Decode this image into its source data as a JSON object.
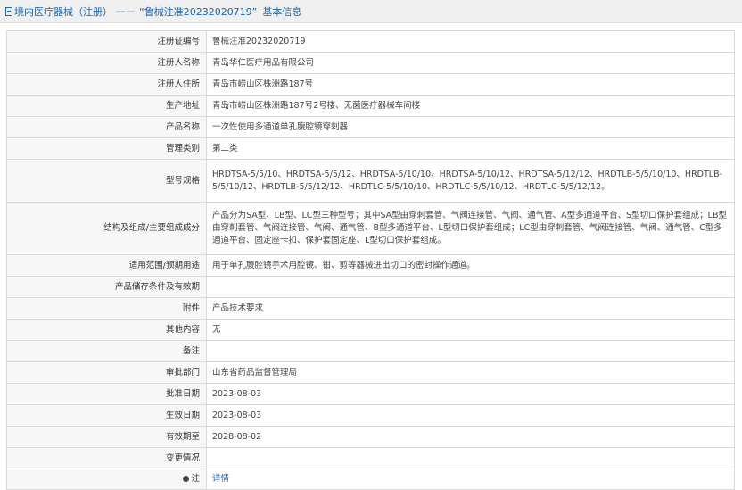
{
  "header": {
    "category": "境内医疗器械（注册）",
    "separator": "——",
    "record_title": "“鲁械注准20232020719”",
    "section": "基本信息"
  },
  "rows": [
    {
      "label": "注册证编号",
      "value": "鲁械注准20232020719"
    },
    {
      "label": "注册人名称",
      "value": "青岛华仁医疗用品有限公司"
    },
    {
      "label": "注册人住所",
      "value": "青岛市崂山区株洲路187号"
    },
    {
      "label": "生产地址",
      "value": "青岛市崂山区株洲路187号2号楼、无菌医疗器械车间楼"
    },
    {
      "label": "产品名称",
      "value": "一次性使用多通道单孔腹腔镜穿刺器"
    },
    {
      "label": "管理类别",
      "value": "第二类"
    },
    {
      "label": "型号规格",
      "value": "HRDTSA-5/5/10、HRDTSA-5/5/12、HRDTSA-5/10/10、HRDTSA-5/10/12、HRDTSA-5/12/12、HRDTLB-5/5/10/10、HRDTLB-5/5/10/12、HRDTLB-5/5/12/12、HRDTLC-5/5/10/10、HRDTLC-5/5/10/12、HRDTLC-5/5/12/12。"
    },
    {
      "label": "结构及组成/主要组成成分",
      "value": "产品分为SA型、LB型、LC型三种型号；其中SA型由穿刺套管、气阀连接管、气阀、通气管、A型多通道平台、S型切口保护套组成；LB型由穿刺套管、气阀连接管、气阀、通气管、B型多通道平台、L型切口保护套组成；LC型由穿刺套管、气阀连接管、气阀、通气管、C型多通道平台、固定座卡扣、保护套固定座、L型切口保护套组成。"
    },
    {
      "label": "适用范围/预期用途",
      "value": "用于单孔腹腔镜手术用腔镜、钳、剪等器械进出切口的密封操作通道。"
    },
    {
      "label": "产品储存条件及有效期",
      "value": ""
    },
    {
      "label": "附件",
      "value": "产品技术要求"
    },
    {
      "label": "其他内容",
      "value": "无"
    },
    {
      "label": "备注",
      "value": ""
    },
    {
      "label": "审批部门",
      "value": "山东省药品监督管理局"
    },
    {
      "label": "批准日期",
      "value": "2023-08-03"
    },
    {
      "label": "生效日期",
      "value": "2023-08-03"
    },
    {
      "label": "有效期至",
      "value": "2028-08-02"
    },
    {
      "label": "变更情况",
      "value": ""
    }
  ],
  "note_row": {
    "label": "注",
    "link": "详情"
  }
}
